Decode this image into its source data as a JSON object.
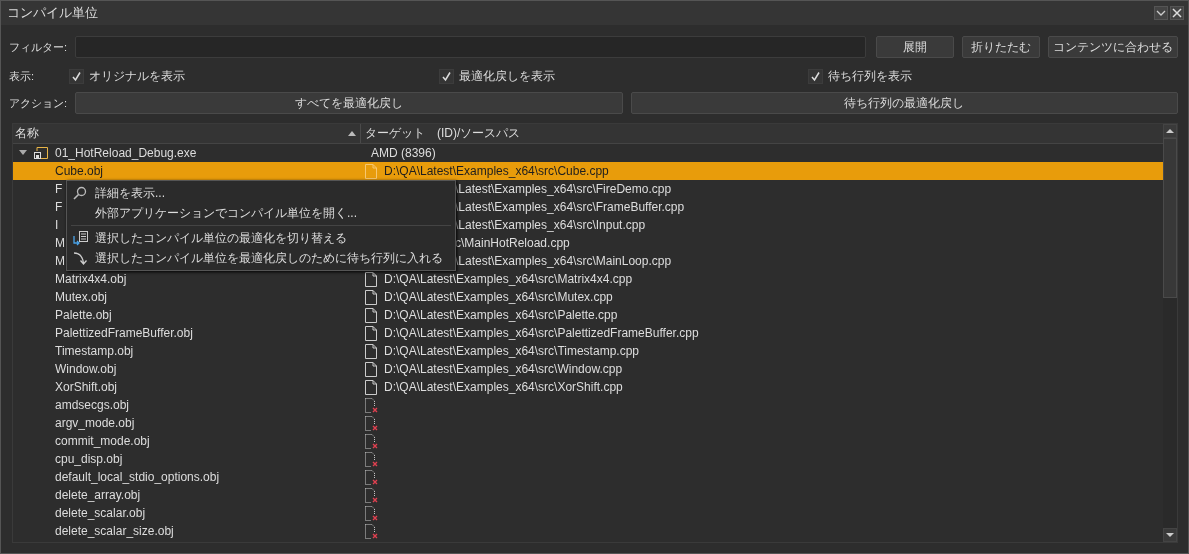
{
  "window": {
    "title": "コンパイル単位"
  },
  "filter": {
    "label": "フィルター:"
  },
  "filter_buttons": [
    "展開",
    "折りたたむ",
    "コンテンツに合わせる"
  ],
  "display": {
    "label": "表示:",
    "options": [
      {
        "label": "オリジナルを表示",
        "checked": true
      },
      {
        "label": "最適化戻しを表示",
        "checked": true
      },
      {
        "label": "待ち行列を表示",
        "checked": true
      }
    ]
  },
  "actions": {
    "label": "アクション:",
    "buttons": [
      "すべてを最適化戻し",
      "待ち行列の最適化戻し"
    ]
  },
  "tree": {
    "columns": [
      {
        "label": "名称",
        "sorted": true
      },
      {
        "label": "ターゲット　(ID)/ソースパス",
        "sorted": false
      }
    ],
    "root": {
      "name": "01_HotReload_Debug.exe",
      "target": "AMD (8396)",
      "expanded": true,
      "children": [
        {
          "name": "Cube.obj",
          "path": "D:\\QA\\Latest\\Examples_x64\\src\\Cube.cpp",
          "kind": "file",
          "selected": true,
          "partial": false
        },
        {
          "name": "F",
          "path": "\\Latest\\Examples_x64\\src\\FireDemo.cpp",
          "selected": false,
          "partial": true
        },
        {
          "name": "F",
          "path": "\\Latest\\Examples_x64\\src\\FrameBuffer.cpp",
          "selected": false,
          "partial": true
        },
        {
          "name": "I",
          "path": "\\Latest\\Examples_x64\\src\\Input.cpp",
          "selected": false,
          "partial": true
        },
        {
          "name": "M",
          "path": "c\\MainHotReload.cpp",
          "selected": false,
          "partial": true
        },
        {
          "name": "M",
          "path": "\\Latest\\Examples_x64\\src\\MainLoop.cpp",
          "selected": false,
          "partial": true
        },
        {
          "name": "Matrix4x4.obj",
          "path": "D:\\QA\\Latest\\Examples_x64\\src\\Matrix4x4.cpp",
          "kind": "file",
          "selected": false,
          "partial": false
        },
        {
          "name": "Mutex.obj",
          "path": "D:\\QA\\Latest\\Examples_x64\\src\\Mutex.cpp",
          "kind": "file",
          "selected": false,
          "partial": false
        },
        {
          "name": "Palette.obj",
          "path": "D:\\QA\\Latest\\Examples_x64\\src\\Palette.cpp",
          "kind": "file",
          "selected": false,
          "partial": false
        },
        {
          "name": "PalettizedFrameBuffer.obj",
          "path": "D:\\QA\\Latest\\Examples_x64\\src\\PalettizedFrameBuffer.cpp",
          "kind": "file",
          "selected": false,
          "partial": false
        },
        {
          "name": "Timestamp.obj",
          "path": "D:\\QA\\Latest\\Examples_x64\\src\\Timestamp.cpp",
          "kind": "file",
          "selected": false,
          "partial": false
        },
        {
          "name": "Window.obj",
          "path": "D:\\QA\\Latest\\Examples_x64\\src\\Window.cpp",
          "kind": "file",
          "selected": false,
          "partial": false
        },
        {
          "name": "XorShift.obj",
          "path": "D:\\QA\\Latest\\Examples_x64\\src\\XorShift.cpp",
          "kind": "file",
          "selected": false,
          "partial": false
        },
        {
          "name": "amdsecgs.obj",
          "kind": "missing",
          "selected": false,
          "partial": false
        },
        {
          "name": "argv_mode.obj",
          "kind": "missing",
          "selected": false,
          "partial": false
        },
        {
          "name": "commit_mode.obj",
          "kind": "missing",
          "selected": false,
          "partial": false
        },
        {
          "name": "cpu_disp.obj",
          "kind": "missing",
          "selected": false,
          "partial": false
        },
        {
          "name": "default_local_stdio_options.obj",
          "kind": "missing",
          "selected": false,
          "partial": false
        },
        {
          "name": "delete_array.obj",
          "kind": "missing",
          "selected": false,
          "partial": false
        },
        {
          "name": "delete_scalar.obj",
          "kind": "missing",
          "selected": false,
          "partial": false
        },
        {
          "name": "delete_scalar_size.obj",
          "kind": "missing",
          "selected": false,
          "partial": false
        }
      ]
    }
  },
  "context_menu": [
    {
      "kind": "search",
      "label": "詳細を表示..."
    },
    {
      "kind": "plain",
      "label": "外部アプリケーションでコンパイル単位を開く..."
    },
    {
      "kind": "separator"
    },
    {
      "kind": "toggle",
      "label": "選択したコンパイル単位の最適化を切り替える"
    },
    {
      "kind": "queue",
      "label": "選択したコンパイル単位を最適化戻しのために待ち行列に入れる"
    }
  ]
}
